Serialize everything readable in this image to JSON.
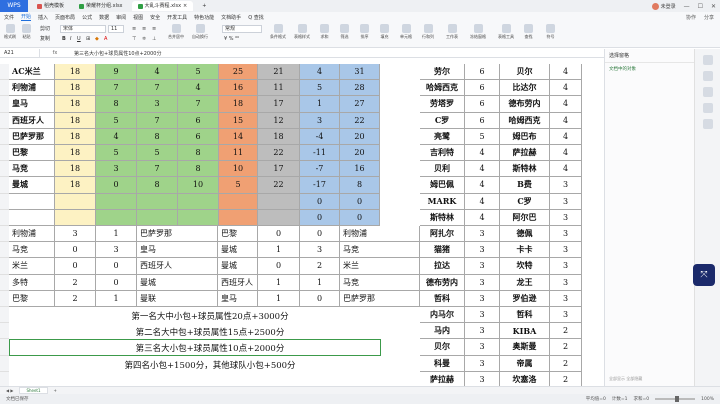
{
  "titlebar": {
    "logo": "WPS",
    "tabs": [
      {
        "label": "稻壳模板",
        "color": "#d9534f"
      },
      {
        "label": "荣耀杯分组.xlsx",
        "color": "#2f9e44"
      },
      {
        "label": "大乱斗赛程.xlsx",
        "color": "#2f9e44"
      }
    ],
    "user": "未登录"
  },
  "menubar": {
    "items": [
      "文件",
      "开始",
      "插入",
      "页面布局",
      "公式",
      "数据",
      "审阅",
      "视图",
      "安全",
      "开发工具",
      "特色功能",
      "文档助手"
    ],
    "active_index": 1,
    "search": "Q 查找",
    "right": [
      "协作",
      "分享"
    ]
  },
  "ribbon": {
    "buttons": [
      "格式刷",
      "粘贴",
      "剪切",
      "复制",
      "合并居中",
      "自动换行",
      "条件格式",
      "表格样式",
      "求和",
      "筛选",
      "排序",
      "填充",
      "单元格",
      "行和列",
      "工作表",
      "冻结窗格",
      "表格工具",
      "查找",
      "符号"
    ],
    "font_name": "宋体",
    "font_size": "11",
    "number_format": "常规"
  },
  "formulabar": {
    "cell_ref": "A21",
    "fx": "fx",
    "formula": "第三名大小包+球员属性10点+2000分"
  },
  "grid": {
    "colors": {
      "name": "#ffffff",
      "yellow": "#fdf2c3",
      "green": "#9fd38a",
      "orange": "#f0a073",
      "gray": "#bdbdbd",
      "blue": "#a9c7e8"
    },
    "teams": [
      "AC米兰",
      "利物浦",
      "皇马",
      "西班牙人",
      "巴萨罗那",
      "巴黎",
      "马竞",
      "曼城",
      "",
      ""
    ],
    "scores": [
      [
        "18",
        "9",
        "4",
        "5",
        "25",
        "21",
        "4",
        "31"
      ],
      [
        "18",
        "7",
        "7",
        "4",
        "16",
        "11",
        "5",
        "28"
      ],
      [
        "18",
        "8",
        "3",
        "7",
        "18",
        "17",
        "1",
        "27"
      ],
      [
        "18",
        "5",
        "7",
        "6",
        "15",
        "12",
        "3",
        "22"
      ],
      [
        "18",
        "4",
        "8",
        "6",
        "14",
        "18",
        "-4",
        "20"
      ],
      [
        "18",
        "5",
        "5",
        "8",
        "11",
        "22",
        "-11",
        "20"
      ],
      [
        "18",
        "3",
        "7",
        "8",
        "10",
        "17",
        "-7",
        "16"
      ],
      [
        "18",
        "0",
        "8",
        "10",
        "5",
        "22",
        "-17",
        "8"
      ],
      [
        "",
        "",
        "",
        "",
        "",
        "",
        "0",
        "0"
      ],
      [
        "",
        "",
        "",
        "",
        "",
        "",
        "0",
        "0"
      ]
    ],
    "matches": [
      [
        "利物浦",
        "3",
        "1",
        "巴萨罗那",
        "巴黎",
        "0",
        "0",
        "利物浦"
      ],
      [
        "马竞",
        "0",
        "3",
        "皇马",
        "曼城",
        "1",
        "3",
        "马竞"
      ],
      [
        "米兰",
        "0",
        "0",
        "西班牙人",
        "曼城",
        "0",
        "2",
        "米兰"
      ],
      [
        "多特",
        "2",
        "0",
        "曼城",
        "西班牙人",
        "1",
        "1",
        "马竞"
      ],
      [
        "巴黎",
        "2",
        "1",
        "曼联",
        "皇马",
        "1",
        "0",
        "巴萨罗那"
      ]
    ],
    "rewards": [
      "第一名大中小包+球员属性20点+3000分",
      "第二名大中包+球员属性15点+2500分",
      "第三名大小包+球员属性10点+2000分",
      "第四名小包+1500分，其他球队小包+500分"
    ],
    "players": [
      [
        "劳尔",
        "6",
        "贝尔",
        "4"
      ],
      [
        "哈姆西克",
        "6",
        "比达尔",
        "4"
      ],
      [
        "劳塔罗",
        "6",
        "德布劳内",
        "4"
      ],
      [
        "C罗",
        "6",
        "哈姆西克",
        "4"
      ],
      [
        "亮鹭",
        "5",
        "姆巴布",
        "4"
      ],
      [
        "吉利特",
        "4",
        "萨拉赫",
        "4"
      ],
      [
        "贝利",
        "4",
        "斯特林",
        "4"
      ],
      [
        "姆巴佩",
        "4",
        "B费",
        "3"
      ],
      [
        "MARK",
        "4",
        "C罗",
        "3"
      ],
      [
        "斯特林",
        "4",
        "阿尔巴",
        "3"
      ],
      [
        "阿扎尔",
        "3",
        "德佩",
        "3"
      ],
      [
        "猫猪",
        "3",
        "卡卡",
        "3"
      ],
      [
        "拉达",
        "3",
        "坎特",
        "3"
      ],
      [
        "德布劳内",
        "3",
        "龙王",
        "3"
      ],
      [
        "哲科",
        "3",
        "罗伯逊",
        "3"
      ],
      [
        "内马尔",
        "3",
        "哲科",
        "3"
      ],
      [
        "马内",
        "3",
        "KIBA",
        "2"
      ],
      [
        "贝尔",
        "3",
        "奥斯曼",
        "2"
      ],
      [
        "科曼",
        "3",
        "帝属",
        "2"
      ],
      [
        "萨拉赫",
        "3",
        "坎塞洛",
        "2"
      ]
    ]
  },
  "rightpanel": {
    "title": "选择窗格",
    "link": "文档中的对象",
    "footer": "全部显示  全部隐藏"
  },
  "sheetbar": {
    "nav": "◀ ▶",
    "tab": "Sheet1",
    "add": "+"
  },
  "statusbar": {
    "left": "文档已保存",
    "right": [
      "平均值=0",
      "计数=1",
      "求和=0"
    ],
    "zoom": "100%"
  }
}
